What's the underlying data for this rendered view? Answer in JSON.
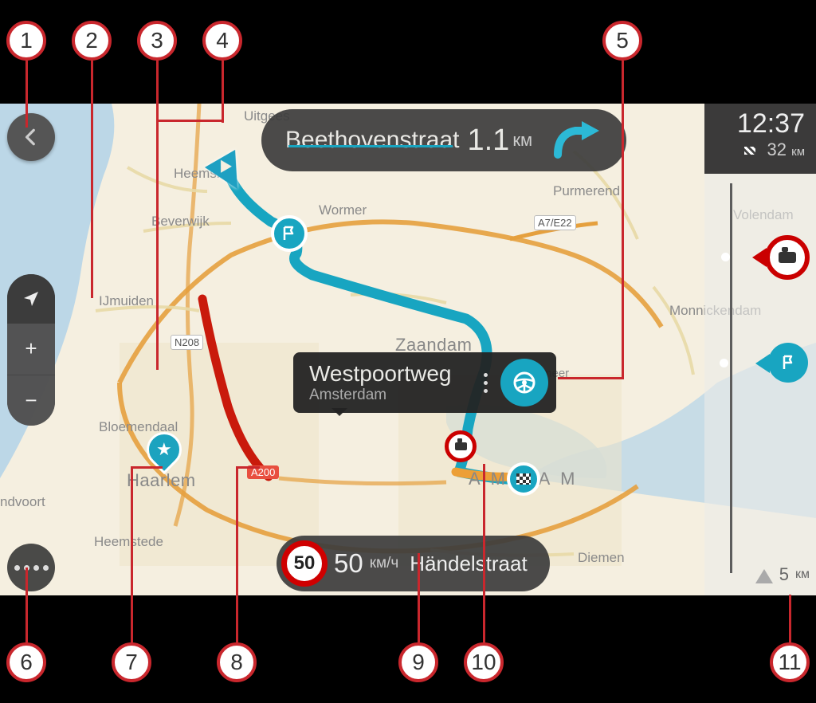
{
  "callouts": {
    "1": "1",
    "2": "2",
    "3": "3",
    "4": "4",
    "5": "5",
    "6": "6",
    "7": "7",
    "8": "8",
    "9": "9",
    "10": "10",
    "11": "11"
  },
  "instruction": {
    "street": "Beethovenstraat",
    "distance_value": "1.1",
    "distance_unit": "км",
    "maneuver": "turn-right"
  },
  "selected_location": {
    "title": "Westpoortweg",
    "subtitle": "Amsterdam",
    "action": "drive"
  },
  "speed_panel": {
    "limit": "50",
    "current_speed": "50",
    "speed_unit": "км/ч",
    "current_street": "Händelstraat"
  },
  "arrival": {
    "time": "12:37",
    "remaining_distance": "32",
    "remaining_unit": "км"
  },
  "route_bar": {
    "scale_value": "5",
    "scale_unit": "км"
  },
  "cities": {
    "uitgeest": "Uitgees",
    "heemskerk": "Heemsk",
    "beverwijk": "Beverwijk",
    "ijmuiden": "IJmuiden",
    "bloemendaal": "Bloemendaal",
    "haarlem": "Haarlem",
    "heemstede": "Heemstede",
    "zandvoort": "ndvoort",
    "wormer": "Wormer",
    "purmerend": "Purmerend",
    "zaandam": "Zaandam",
    "amsterdam": "A M S         A M",
    "diemen": "Diemen",
    "volendam": "Volendam",
    "monnickendam": "Monnickendam",
    "landsmeer": "meer"
  },
  "road_labels": {
    "n208": "N208",
    "a200": "A200",
    "a7e22": "A7/E22"
  },
  "controls": {
    "back": "back",
    "recenter": "recenter",
    "zoom_in": "+",
    "zoom_out": "−",
    "menu": "menu"
  }
}
